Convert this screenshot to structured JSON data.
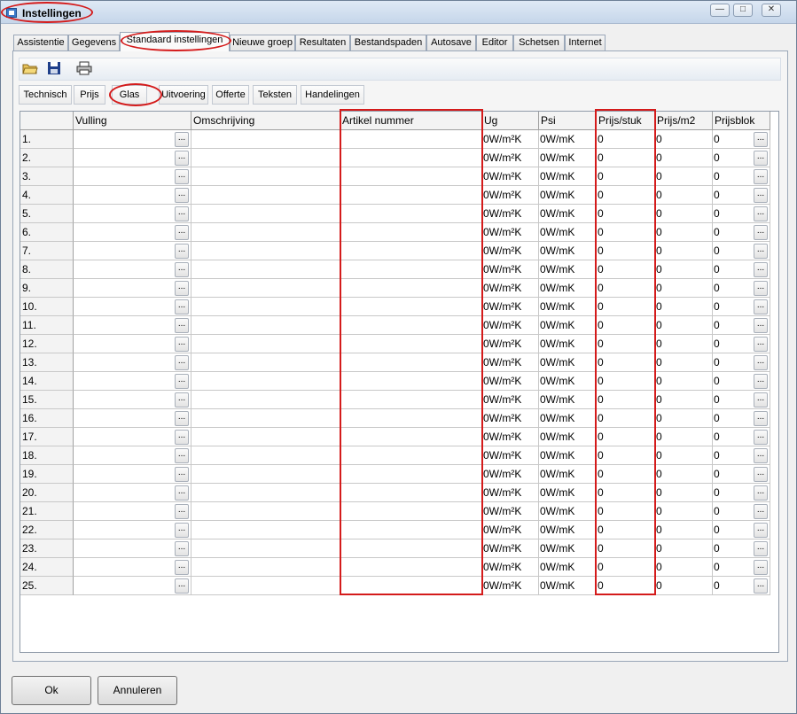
{
  "window": {
    "title": "Instellingen"
  },
  "tabs": [
    "Assistentie",
    "Gegevens",
    "Standaard instellingen",
    "Nieuwe groep",
    "Resultaten",
    "Bestandspaden",
    "Autosave",
    "Editor",
    "Schetsen",
    "Internet"
  ],
  "toolbar": {
    "icons": [
      "open-folder-icon",
      "save-icon",
      "print-icon"
    ]
  },
  "subtabs": [
    "Technisch",
    "Prijs",
    "Glas",
    "Uitvoering",
    "Offerte",
    "Teksten",
    "Handelingen"
  ],
  "table": {
    "columns": [
      "",
      "Vulling",
      "Omschrijving",
      "Artikel nummer",
      "Ug",
      "Psi",
      "Prijs/stuk",
      "Prijs/m2",
      "Prijsblok"
    ],
    "rows": [
      {
        "n": "1.",
        "ug": "0W/m²K",
        "psi": "0W/mK",
        "stuk": "0",
        "m2": "0",
        "blok": "0"
      },
      {
        "n": "2.",
        "ug": "0W/m²K",
        "psi": "0W/mK",
        "stuk": "0",
        "m2": "0",
        "blok": "0"
      },
      {
        "n": "3.",
        "ug": "0W/m²K",
        "psi": "0W/mK",
        "stuk": "0",
        "m2": "0",
        "blok": "0"
      },
      {
        "n": "4.",
        "ug": "0W/m²K",
        "psi": "0W/mK",
        "stuk": "0",
        "m2": "0",
        "blok": "0"
      },
      {
        "n": "5.",
        "ug": "0W/m²K",
        "psi": "0W/mK",
        "stuk": "0",
        "m2": "0",
        "blok": "0"
      },
      {
        "n": "6.",
        "ug": "0W/m²K",
        "psi": "0W/mK",
        "stuk": "0",
        "m2": "0",
        "blok": "0"
      },
      {
        "n": "7.",
        "ug": "0W/m²K",
        "psi": "0W/mK",
        "stuk": "0",
        "m2": "0",
        "blok": "0"
      },
      {
        "n": "8.",
        "ug": "0W/m²K",
        "psi": "0W/mK",
        "stuk": "0",
        "m2": "0",
        "blok": "0"
      },
      {
        "n": "9.",
        "ug": "0W/m²K",
        "psi": "0W/mK",
        "stuk": "0",
        "m2": "0",
        "blok": "0"
      },
      {
        "n": "10.",
        "ug": "0W/m²K",
        "psi": "0W/mK",
        "stuk": "0",
        "m2": "0",
        "blok": "0"
      },
      {
        "n": "11.",
        "ug": "0W/m²K",
        "psi": "0W/mK",
        "stuk": "0",
        "m2": "0",
        "blok": "0"
      },
      {
        "n": "12.",
        "ug": "0W/m²K",
        "psi": "0W/mK",
        "stuk": "0",
        "m2": "0",
        "blok": "0"
      },
      {
        "n": "13.",
        "ug": "0W/m²K",
        "psi": "0W/mK",
        "stuk": "0",
        "m2": "0",
        "blok": "0"
      },
      {
        "n": "14.",
        "ug": "0W/m²K",
        "psi": "0W/mK",
        "stuk": "0",
        "m2": "0",
        "blok": "0"
      },
      {
        "n": "15.",
        "ug": "0W/m²K",
        "psi": "0W/mK",
        "stuk": "0",
        "m2": "0",
        "blok": "0"
      },
      {
        "n": "16.",
        "ug": "0W/m²K",
        "psi": "0W/mK",
        "stuk": "0",
        "m2": "0",
        "blok": "0"
      },
      {
        "n": "17.",
        "ug": "0W/m²K",
        "psi": "0W/mK",
        "stuk": "0",
        "m2": "0",
        "blok": "0"
      },
      {
        "n": "18.",
        "ug": "0W/m²K",
        "psi": "0W/mK",
        "stuk": "0",
        "m2": "0",
        "blok": "0"
      },
      {
        "n": "19.",
        "ug": "0W/m²K",
        "psi": "0W/mK",
        "stuk": "0",
        "m2": "0",
        "blok": "0"
      },
      {
        "n": "20.",
        "ug": "0W/m²K",
        "psi": "0W/mK",
        "stuk": "0",
        "m2": "0",
        "blok": "0"
      },
      {
        "n": "21.",
        "ug": "0W/m²K",
        "psi": "0W/mK",
        "stuk": "0",
        "m2": "0",
        "blok": "0"
      },
      {
        "n": "22.",
        "ug": "0W/m²K",
        "psi": "0W/mK",
        "stuk": "0",
        "m2": "0",
        "blok": "0"
      },
      {
        "n": "23.",
        "ug": "0W/m²K",
        "psi": "0W/mK",
        "stuk": "0",
        "m2": "0",
        "blok": "0"
      },
      {
        "n": "24.",
        "ug": "0W/m²K",
        "psi": "0W/mK",
        "stuk": "0",
        "m2": "0",
        "blok": "0"
      },
      {
        "n": "25.",
        "ug": "0W/m²K",
        "psi": "0W/mK",
        "stuk": "0",
        "m2": "0",
        "blok": "0"
      }
    ],
    "dots_label": "..."
  },
  "buttons": {
    "ok": "Ok",
    "cancel": "Annuleren"
  },
  "colors": {
    "highlight": "#d41b1b"
  }
}
